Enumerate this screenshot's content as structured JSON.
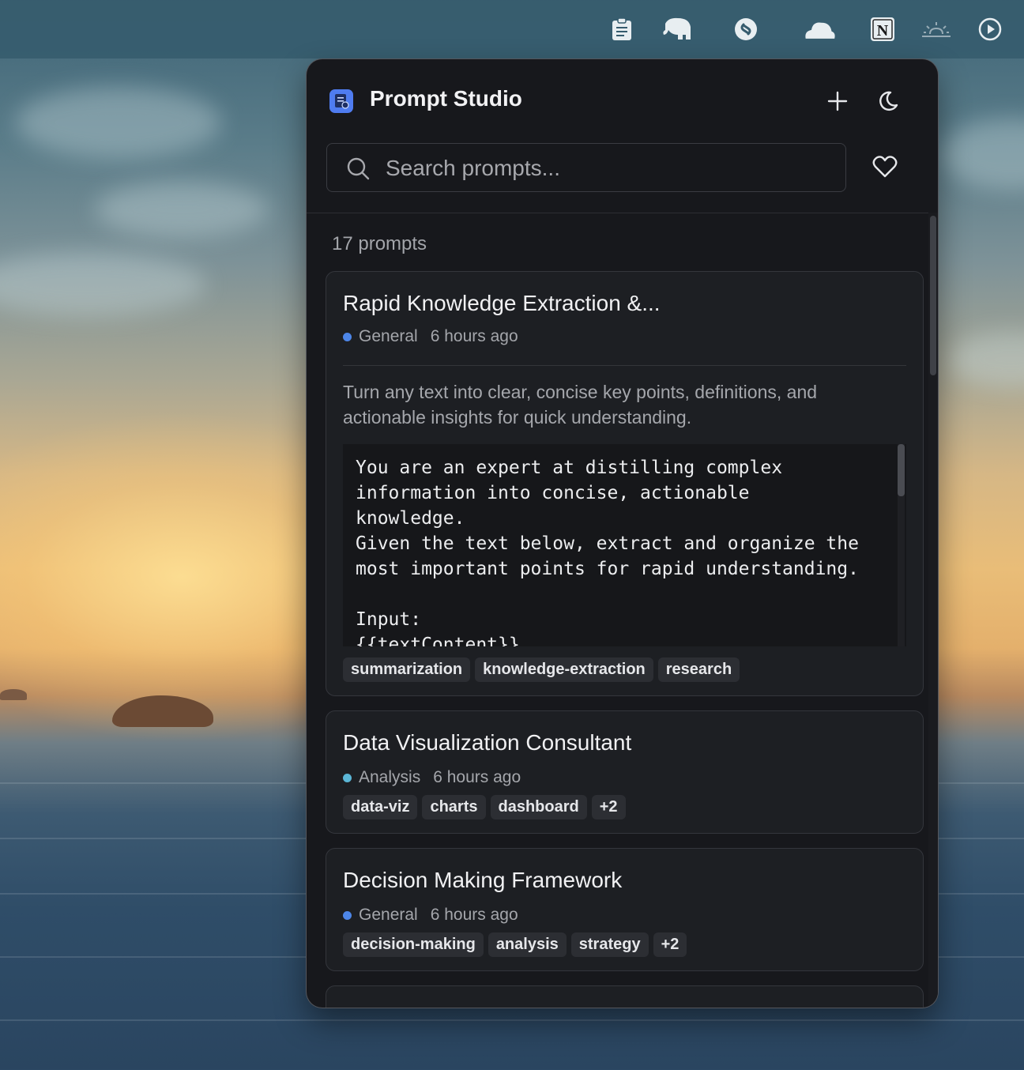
{
  "colors": {
    "accent": "#4f7cf0",
    "general_dot": "#4d86e8",
    "analysis_dot": "#5bb6d6",
    "panel_bg": "#17181c",
    "card_bg": "#1d1f23"
  },
  "menubar": {
    "icons": [
      "clipboard-icon",
      "elephant-icon",
      "shazam-icon",
      "cloud-icon",
      "notion-icon",
      "sunrise-icon",
      "play-circle-icon"
    ],
    "notion_letter": "N"
  },
  "app": {
    "title": "Prompt Studio",
    "add_label": "+",
    "theme_icon": "moon-icon"
  },
  "search": {
    "placeholder": "Search prompts...",
    "value": ""
  },
  "list": {
    "count_label": "17 prompts",
    "prompts": [
      {
        "title": "Rapid Knowledge Extraction &...",
        "category": "General",
        "time": "6 hours ago",
        "description": "Turn any text into clear, concise key points, definitions, and actionable insights for quick understanding.",
        "content": "You are an expert at distilling complex\ninformation into concise, actionable\nknowledge.\nGiven the text below, extract and organize the\nmost important points for rapid understanding.\n\nInput:\n{{textContent}}",
        "tags": [
          "summarization",
          "knowledge-extraction",
          "research"
        ]
      },
      {
        "title": "Data Visualization Consultant",
        "category": "Analysis",
        "time": "6 hours ago",
        "tags": [
          "data-viz",
          "charts",
          "dashboard",
          "+2"
        ]
      },
      {
        "title": "Decision Making Framework",
        "category": "General",
        "time": "6 hours ago",
        "tags": [
          "decision-making",
          "analysis",
          "strategy",
          "+2"
        ]
      }
    ]
  }
}
